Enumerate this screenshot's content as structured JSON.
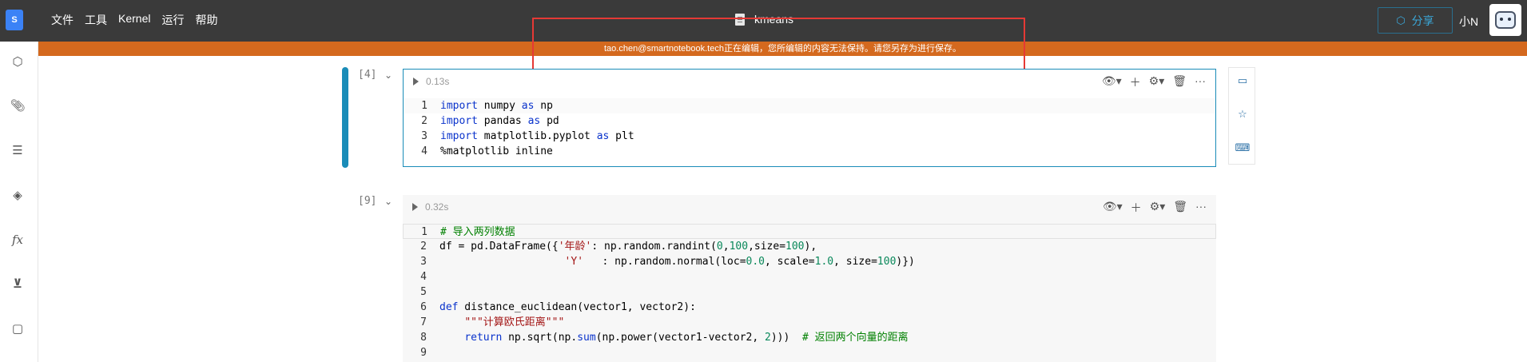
{
  "app": {
    "logo_text": "S",
    "menu": [
      "文件",
      "工具",
      "Kernel",
      "运行",
      "帮助"
    ],
    "title": "kmeans",
    "share_label": "分享",
    "user_name": "小N"
  },
  "banner": {
    "message": "tao.chen@smartnotebook.tech正在编辑，您所编辑的内容无法保持。请您另存为进行保存。"
  },
  "sidebar": {
    "icons": [
      "cube-icon",
      "paperclip-icon",
      "list-icon",
      "layers-icon",
      "function-icon",
      "bookmark-v-icon",
      "code-file-icon"
    ],
    "fx_label": "fx"
  },
  "cells": [
    {
      "exec_count": "[4]",
      "exec_time": "0.13s",
      "lines": [
        {
          "n": "1",
          "parts": [
            [
              "kw",
              "import"
            ],
            [
              "",
              " numpy "
            ],
            [
              "kw",
              "as"
            ],
            [
              "",
              " np"
            ]
          ]
        },
        {
          "n": "2",
          "parts": [
            [
              "kw",
              "import"
            ],
            [
              "",
              " pandas "
            ],
            [
              "kw",
              "as"
            ],
            [
              "",
              " pd"
            ]
          ]
        },
        {
          "n": "3",
          "parts": [
            [
              "kw",
              "import"
            ],
            [
              "",
              " matplotlib.pyplot "
            ],
            [
              "kw",
              "as"
            ],
            [
              "",
              " plt"
            ]
          ]
        },
        {
          "n": "4",
          "parts": [
            [
              "",
              "%matplotlib inline"
            ]
          ]
        }
      ]
    },
    {
      "exec_count": "[9]",
      "exec_time": "0.32s",
      "lines": [
        {
          "n": "1",
          "parts": [
            [
              "cmt",
              "# 导入两列数据"
            ]
          ]
        },
        {
          "n": "2",
          "parts": [
            [
              "",
              "df = pd.DataFrame({"
            ],
            [
              "str",
              "'年龄'"
            ],
            [
              "",
              ": np.random.randint("
            ],
            [
              "num",
              "0"
            ],
            [
              "",
              ","
            ],
            [
              "num",
              "100"
            ],
            [
              "",
              ",size="
            ],
            [
              "num",
              "100"
            ],
            [
              "",
              "),"
            ]
          ]
        },
        {
          "n": "3",
          "parts": [
            [
              "",
              "                    "
            ],
            [
              "str",
              "'Y'"
            ],
            [
              "",
              "   : np.random.normal(loc="
            ],
            [
              "num",
              "0.0"
            ],
            [
              "",
              ", scale="
            ],
            [
              "num",
              "1.0"
            ],
            [
              "",
              ", size="
            ],
            [
              "num",
              "100"
            ],
            [
              "",
              ")})"
            ]
          ]
        },
        {
          "n": "4",
          "parts": [
            [
              "",
              ""
            ]
          ]
        },
        {
          "n": "5",
          "parts": [
            [
              "",
              ""
            ]
          ]
        },
        {
          "n": "6",
          "parts": [
            [
              "kw",
              "def"
            ],
            [
              "",
              " distance_euclidean(vector1, vector2):"
            ]
          ]
        },
        {
          "n": "7",
          "parts": [
            [
              "",
              "    "
            ],
            [
              "str",
              "\"\"\"计算欧氏距离\"\"\""
            ]
          ]
        },
        {
          "n": "8",
          "parts": [
            [
              "",
              "    "
            ],
            [
              "kw",
              "return"
            ],
            [
              "",
              " np.sqrt(np."
            ],
            [
              "fn",
              "sum"
            ],
            [
              "",
              "(np.power(vector1-vector2, "
            ],
            [
              "num",
              "2"
            ],
            [
              "",
              ")))  "
            ],
            [
              "cmt",
              "# 返回两个向量的距离"
            ]
          ]
        },
        {
          "n": "9",
          "parts": [
            [
              "",
              ""
            ]
          ]
        }
      ]
    }
  ],
  "colors": {
    "topbar": "#3a3a3a",
    "banner": "#d4691e",
    "accent": "#1a8cb8",
    "highlight_box": "#e53935"
  }
}
